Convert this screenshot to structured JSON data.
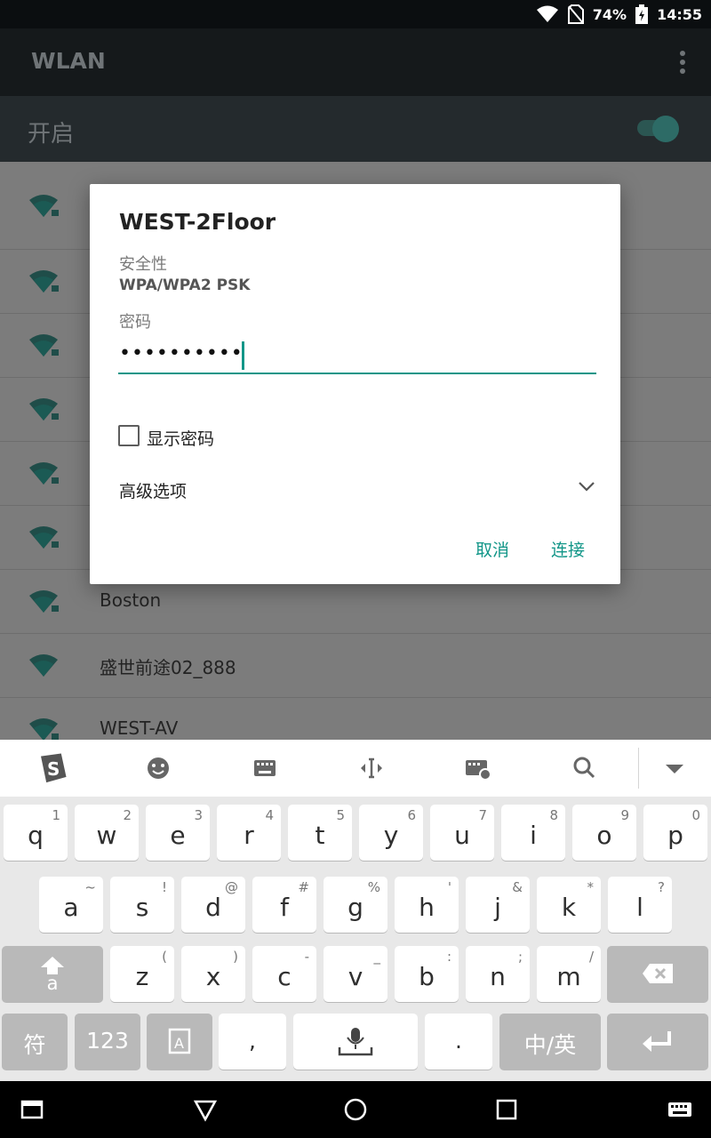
{
  "status": {
    "battery": "74%",
    "time": "14:55"
  },
  "appbar": {
    "title": "WLAN"
  },
  "switch": {
    "label": "开启",
    "on": true
  },
  "networks": [
    {
      "name": ""
    },
    {
      "name": ""
    },
    {
      "name": ""
    },
    {
      "name": ""
    },
    {
      "name": ""
    },
    {
      "name": ""
    },
    {
      "name": "Boston"
    },
    {
      "name": "盛世前途02_888"
    },
    {
      "name": "WEST-AV"
    }
  ],
  "dialog": {
    "title": "WEST-2Floor",
    "security_label": "安全性",
    "security_value": "WPA/WPA2 PSK",
    "password_label": "密码",
    "password_value": "••••••••••",
    "show_password_label": "显示密码",
    "show_password_checked": false,
    "advanced_label": "高级选项",
    "cancel_label": "取消",
    "connect_label": "连接",
    "accent": "#129688"
  },
  "keyboard": {
    "row1": [
      {
        "main": "q",
        "sub": "1"
      },
      {
        "main": "w",
        "sub": "2"
      },
      {
        "main": "e",
        "sub": "3"
      },
      {
        "main": "r",
        "sub": "4"
      },
      {
        "main": "t",
        "sub": "5"
      },
      {
        "main": "y",
        "sub": "6"
      },
      {
        "main": "u",
        "sub": "7"
      },
      {
        "main": "i",
        "sub": "8"
      },
      {
        "main": "o",
        "sub": "9"
      },
      {
        "main": "p",
        "sub": "0"
      }
    ],
    "row2": [
      {
        "main": "a",
        "sub": "~"
      },
      {
        "main": "s",
        "sub": "!"
      },
      {
        "main": "d",
        "sub": "@"
      },
      {
        "main": "f",
        "sub": "#"
      },
      {
        "main": "g",
        "sub": "%"
      },
      {
        "main": "h",
        "sub": "'"
      },
      {
        "main": "j",
        "sub": "&"
      },
      {
        "main": "k",
        "sub": "*"
      },
      {
        "main": "l",
        "sub": "?"
      }
    ],
    "row3": [
      {
        "main": "z",
        "sub": "("
      },
      {
        "main": "x",
        "sub": ")"
      },
      {
        "main": "c",
        "sub": "-"
      },
      {
        "main": "v",
        "sub": "_"
      },
      {
        "main": "b",
        "sub": ":"
      },
      {
        "main": "n",
        "sub": ";"
      },
      {
        "main": "m",
        "sub": "/"
      }
    ],
    "shift_label": "a",
    "symbols_label": "符",
    "numbers_label": "123",
    "comma_label": ",",
    "period_label": ".",
    "lang_label": "中/英"
  }
}
